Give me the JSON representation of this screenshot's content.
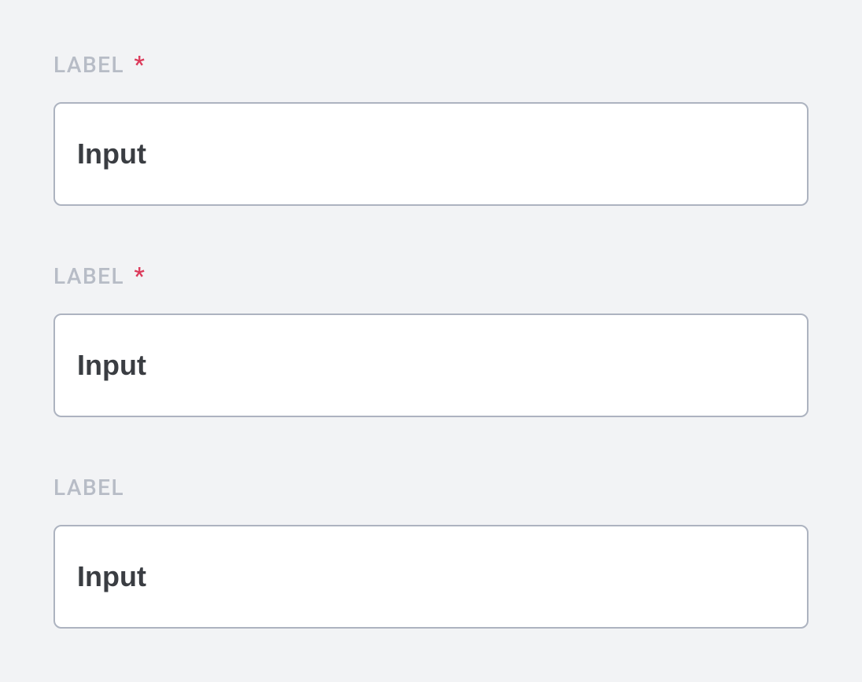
{
  "fields": [
    {
      "label": "LABEL",
      "required": true,
      "required_mark": "*",
      "value": "Input"
    },
    {
      "label": "LABEL",
      "required": true,
      "required_mark": "*",
      "value": "Input"
    },
    {
      "label": "LABEL",
      "required": false,
      "required_mark": "",
      "value": "Input"
    }
  ]
}
